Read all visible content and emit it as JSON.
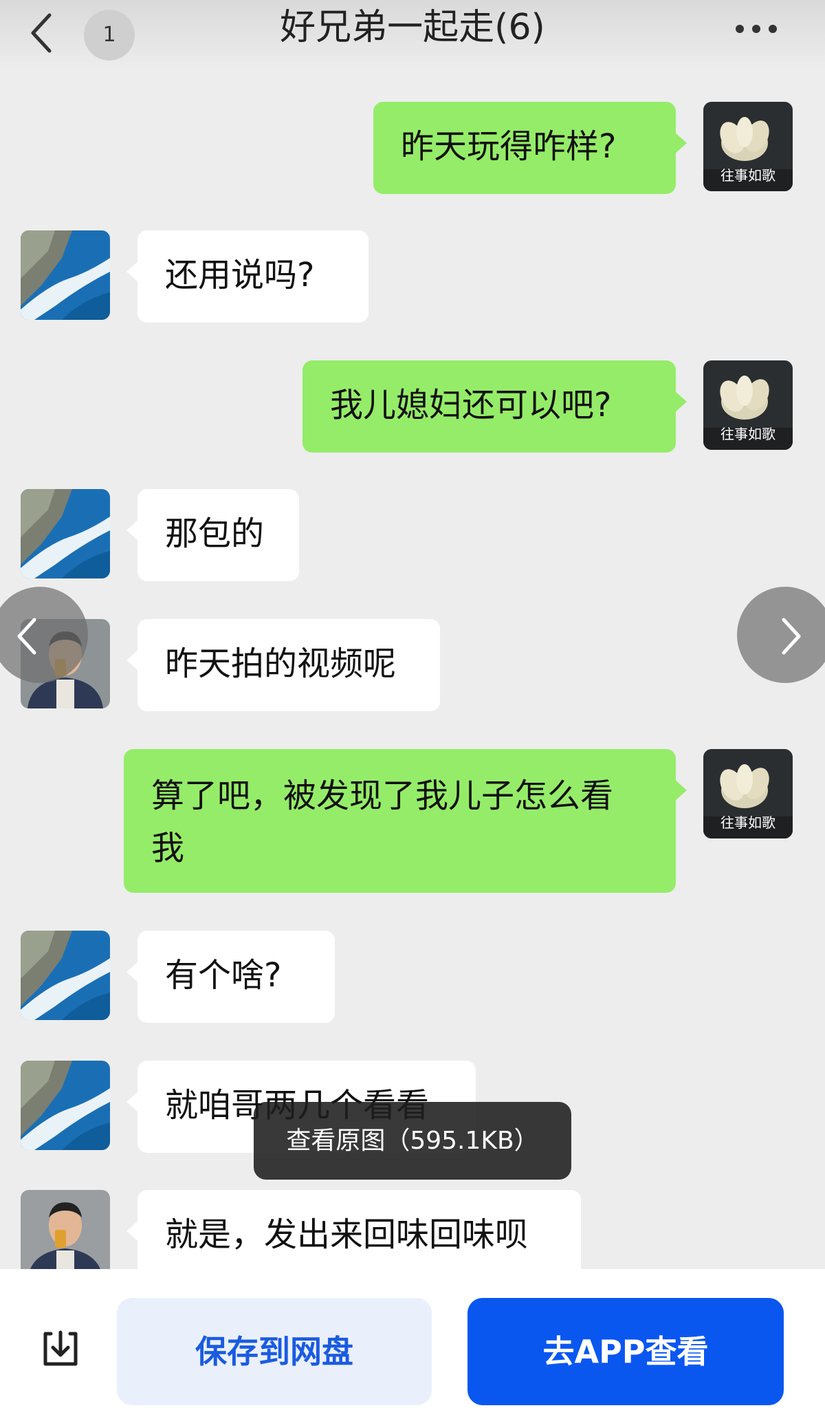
{
  "header": {
    "title": "好兄弟一起走(6)",
    "unread_count": "1",
    "back_icon": "chevron-left-icon",
    "more_icon": "more-dots-icon"
  },
  "avatars": {
    "me_label": "往事如歌",
    "me_icon": "lotus-flower-avatar",
    "friend_a_icon": "coast-cliff-avatar",
    "friend_b_icon": "man-drinking-avatar"
  },
  "messages": [
    {
      "side": "out",
      "sender": "me",
      "text": "昨天玩得咋样?"
    },
    {
      "side": "in",
      "sender": "friend_a",
      "text": "还用说吗?"
    },
    {
      "side": "out",
      "sender": "me",
      "text": "我儿媳妇还可以吧?"
    },
    {
      "side": "in",
      "sender": "friend_a",
      "text": "那包的"
    },
    {
      "side": "in",
      "sender": "friend_b",
      "text": "昨天拍的视频呢"
    },
    {
      "side": "out",
      "sender": "me",
      "text": "算了吧，被发现了我儿子怎么看",
      "text_line2": "我"
    },
    {
      "side": "in",
      "sender": "friend_a",
      "text": "有个啥?"
    },
    {
      "side": "in",
      "sender": "friend_a",
      "text": "就咱哥两几个看看"
    },
    {
      "side": "in",
      "sender": "friend_b",
      "text": "就是，发出来回味回味呗"
    }
  ],
  "viewer": {
    "toast": "查看原图（595.1KB）",
    "prev_icon": "chevron-left-icon",
    "next_icon": "chevron-right-icon"
  },
  "bottom_bar": {
    "download_icon": "download-icon",
    "save_label": "保存到网盘",
    "app_label": "去APP查看"
  },
  "colors": {
    "outgoing_bubble": "#95ec69",
    "incoming_bubble": "#ffffff",
    "background": "#ededed",
    "primary_button": "#0a57f0",
    "secondary_button": "#eaf0fb"
  }
}
